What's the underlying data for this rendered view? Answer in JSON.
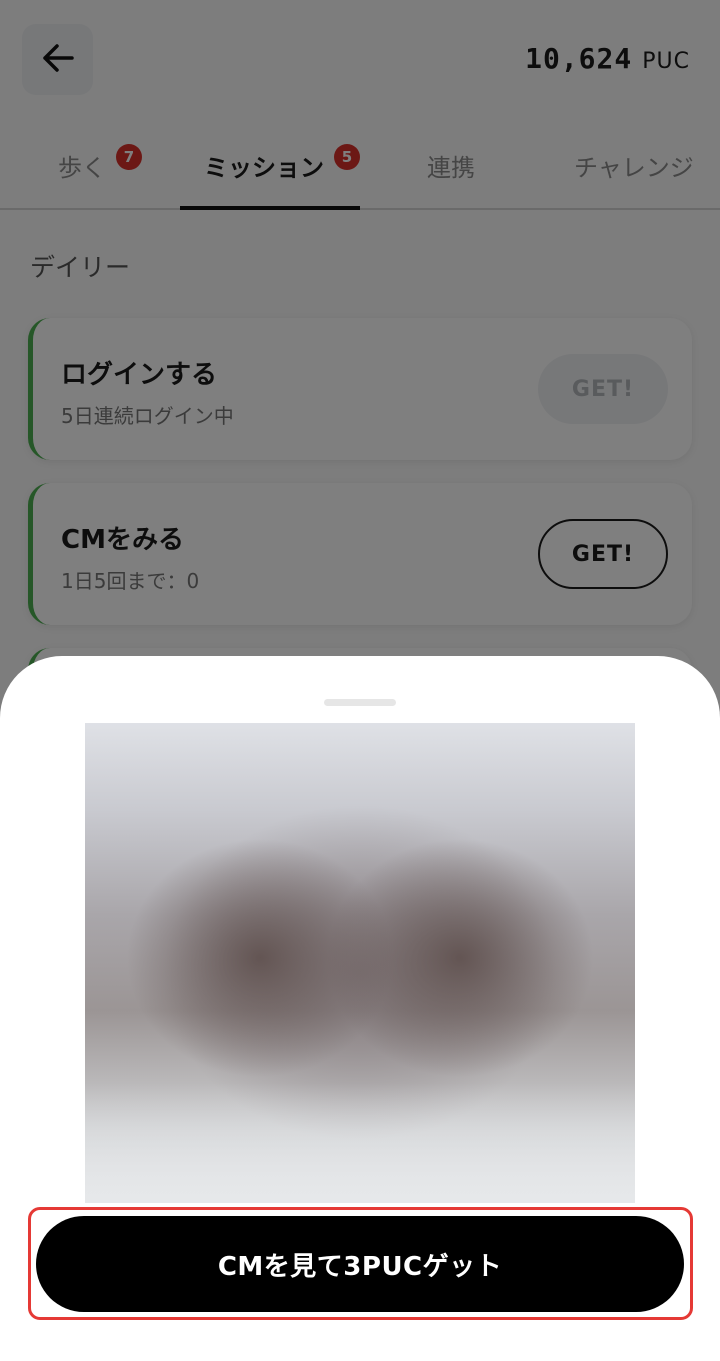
{
  "header": {
    "back_icon": "arrow-left-icon",
    "balance_amount": "10,624",
    "balance_unit": "PUC"
  },
  "tabs": [
    {
      "label": "歩く",
      "badge": "7",
      "active": false
    },
    {
      "label": "ミッション",
      "badge": "5",
      "active": true
    },
    {
      "label": "連携",
      "badge": "",
      "active": false
    },
    {
      "label": "チャレンジ",
      "badge": "",
      "active": false
    }
  ],
  "section": {
    "title": "デイリー"
  },
  "missions": [
    {
      "title": "ログインする",
      "subtitle": "5日連続ログイン中",
      "button": "GET!",
      "state": "disabled"
    },
    {
      "title": "CMをみる",
      "subtitle": "1日5回まで：0",
      "button": "GET!",
      "state": "enabled"
    }
  ],
  "sheet": {
    "cta_label": "CMを見て3PUCゲット"
  },
  "colors": {
    "accent_green": "#4caf50",
    "badge_red": "#d9312b",
    "highlight_red": "#e53935",
    "cta_black": "#000000"
  }
}
